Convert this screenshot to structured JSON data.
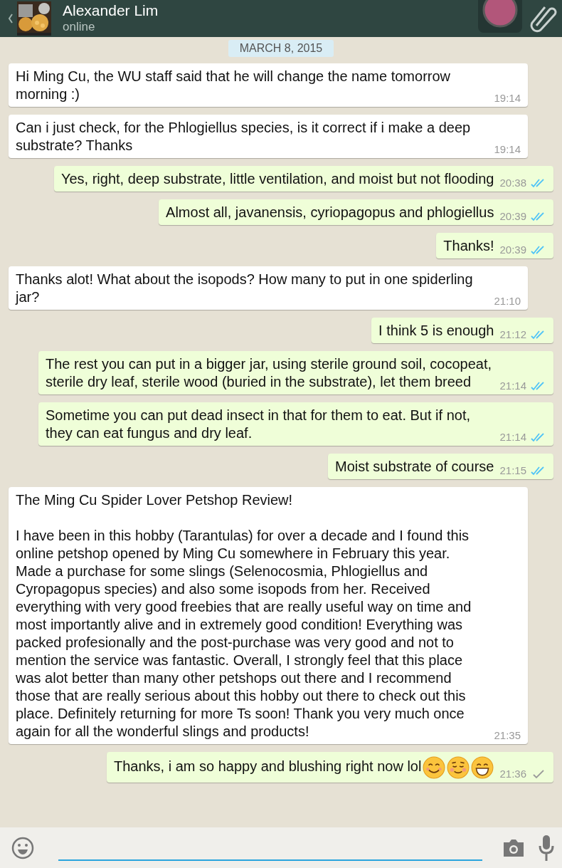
{
  "header": {
    "contact_name": "Alexander Lim",
    "status": "online"
  },
  "date_badge": "MARCH 8, 2015",
  "messages": [
    {
      "kind": "incoming",
      "text": "Hi Ming Cu, the WU staff said that he will change the name tomorrow morning :)",
      "time": "19:14"
    },
    {
      "kind": "incoming",
      "text": "Can i just check, for the Phlogiellus species, is it correct if i make a deep substrate? Thanks",
      "time": "19:14"
    },
    {
      "kind": "outgoing",
      "text": "Yes, right, deep substrate, little ventilation, and moist but not flooding",
      "time": "20:38",
      "read": true
    },
    {
      "kind": "outgoing",
      "text": "Almost all, javanensis, cyriopagopus and phlogiellus",
      "time": "20:39",
      "read": true
    },
    {
      "kind": "outgoing",
      "text": "Thanks!",
      "time": "20:39",
      "read": true
    },
    {
      "kind": "incoming",
      "text": "Thanks alot! What about the isopods? How many to put in one spiderling jar?",
      "time": "21:10"
    },
    {
      "kind": "outgoing",
      "text": "I think 5 is enough",
      "time": "21:12",
      "read": true
    },
    {
      "kind": "outgoing",
      "text": "The rest you can put in a bigger jar, using sterile ground soil, cocopeat, sterile dry leaf, sterile wood (buried in the substrate), let them breed",
      "time": "21:14",
      "read": true
    },
    {
      "kind": "outgoing",
      "text": "Sometime you can put dead insect in that for them to eat. But if not, they can eat fungus and dry leaf.",
      "time": "21:14",
      "read": true
    },
    {
      "kind": "outgoing",
      "text": "Moist substrate of course",
      "time": "21:15",
      "read": true
    },
    {
      "kind": "incoming",
      "text": "The Ming Cu Spider Lover Petshop Review!\n\nI have been in this hobby (Tarantulas) for over a decade and I found this online petshop opened by Ming Cu somewhere in February this year. Made a purchase for some slings (Selenocosmia, Phlogiellus and Cyropagopus species) and also some isopods from her. Received everything with very good freebies that are really useful way on time and most importantly alive and in extremely good condition! Everything was packed profesionally and the post-purchase was very good and not to mention the service was fantastic. Overall, I strongly feel that this place was alot better than many other petshops out there and I recommend those that are really serious about this hobby out there to check out this place. Definitely returning for more Ts soon! Thank you very much once again for all the wonderful slings and products!",
      "time": "21:35"
    },
    {
      "kind": "outgoing",
      "text": "Thanks, i am so happy and blushing right now lol",
      "emojis": [
        {
          "kind": "smile"
        },
        {
          "kind": "blush"
        },
        {
          "kind": "grin"
        }
      ],
      "time": "21:36",
      "read": false
    }
  ]
}
